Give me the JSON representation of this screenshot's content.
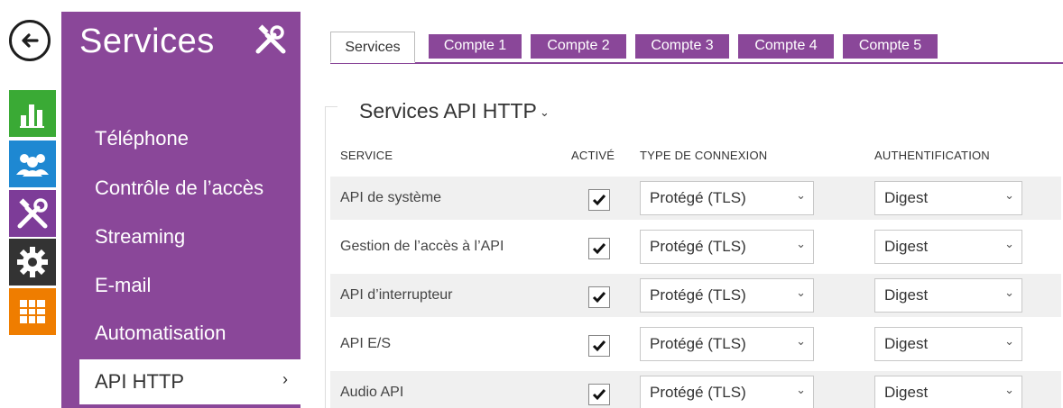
{
  "rail": {
    "icons": [
      "back-arrow-icon",
      "status-chart-icon",
      "users-icon",
      "services-tools-icon",
      "hardware-gear-icon",
      "system-grid-icon"
    ]
  },
  "sidebar": {
    "title": "Services",
    "items": [
      {
        "label": "Téléphone"
      },
      {
        "label": "Contrôle de l’accès"
      },
      {
        "label": "Streaming"
      },
      {
        "label": "E-mail"
      },
      {
        "label": "Automatisation"
      },
      {
        "label": "API HTTP",
        "active": true
      }
    ],
    "active_chevron": "›"
  },
  "tabs": [
    {
      "label": "Services",
      "active": true
    },
    {
      "label": "Compte 1"
    },
    {
      "label": "Compte 2"
    },
    {
      "label": "Compte 3"
    },
    {
      "label": "Compte 4"
    },
    {
      "label": "Compte 5"
    }
  ],
  "section": {
    "title": "Services API HTTP",
    "caret": "⌄"
  },
  "table": {
    "headers": [
      "SERVICE",
      "ACTIVÉ",
      "TYPE DE CONNEXION",
      "AUTHENTIFICATION"
    ],
    "rows": [
      {
        "service": "API de système",
        "enabled": true,
        "connection": "Protégé (TLS)",
        "auth": "Digest"
      },
      {
        "service": "Gestion de l’accès à l’API",
        "enabled": true,
        "connection": "Protégé (TLS)",
        "auth": "Digest"
      },
      {
        "service": "API d’interrupteur",
        "enabled": true,
        "connection": "Protégé (TLS)",
        "auth": "Digest"
      },
      {
        "service": "API E/S",
        "enabled": true,
        "connection": "Protégé (TLS)",
        "auth": "Digest"
      },
      {
        "service": "Audio API",
        "enabled": true,
        "connection": "Protégé (TLS)",
        "auth": "Digest"
      }
    ],
    "select_chevron": "⌄"
  },
  "colors": {
    "accent_purple": "#8a4799",
    "status_green": "#3aaa35",
    "users_blue": "#1e88d2",
    "hardware_dark": "#333333",
    "system_orange": "#ef7d00",
    "row_shade": "#f0f0f0"
  }
}
